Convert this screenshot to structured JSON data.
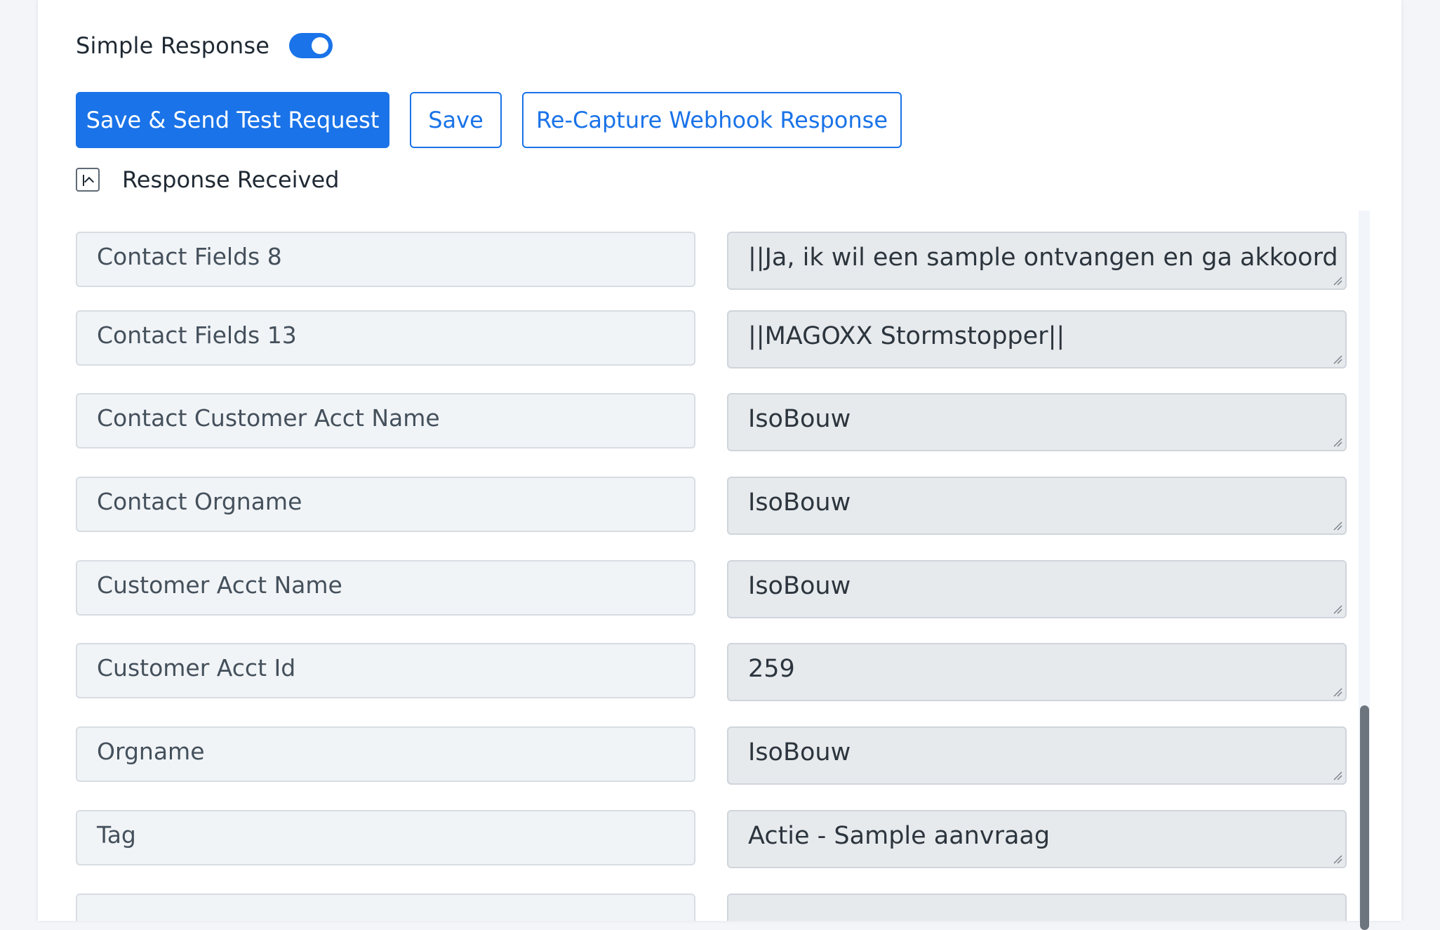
{
  "simple_response": {
    "label": "Simple Response",
    "enabled": true
  },
  "buttons": {
    "save_send": "Save & Send Test Request",
    "save": "Save",
    "recapture": "Re-Capture Webhook Response"
  },
  "response_section": {
    "label": "Response Received",
    "collapse_icon": "chevron-up-icon"
  },
  "fields": [
    {
      "key": "Contact Fields 8",
      "value": "||Ja, ik wil een sample ontvangen en ga akkoord"
    },
    {
      "key": "Contact Fields 13",
      "value": "||MAGOXX Stormstopper||"
    },
    {
      "key": "Contact Customer Acct Name",
      "value": "IsoBouw"
    },
    {
      "key": "Contact Orgname",
      "value": "IsoBouw"
    },
    {
      "key": "Customer Acct Name",
      "value": "IsoBouw"
    },
    {
      "key": "Customer Acct Id",
      "value": "259"
    },
    {
      "key": "Orgname",
      "value": "IsoBouw"
    },
    {
      "key": "Tag",
      "value": "Actie - Sample aanvraag"
    },
    {
      "key": "",
      "value": ""
    }
  ],
  "colors": {
    "accent": "#1a73e8",
    "key_bg": "#f1f4f7",
    "value_bg": "#e7eaed",
    "scroll_thumb": "#6c757d"
  }
}
